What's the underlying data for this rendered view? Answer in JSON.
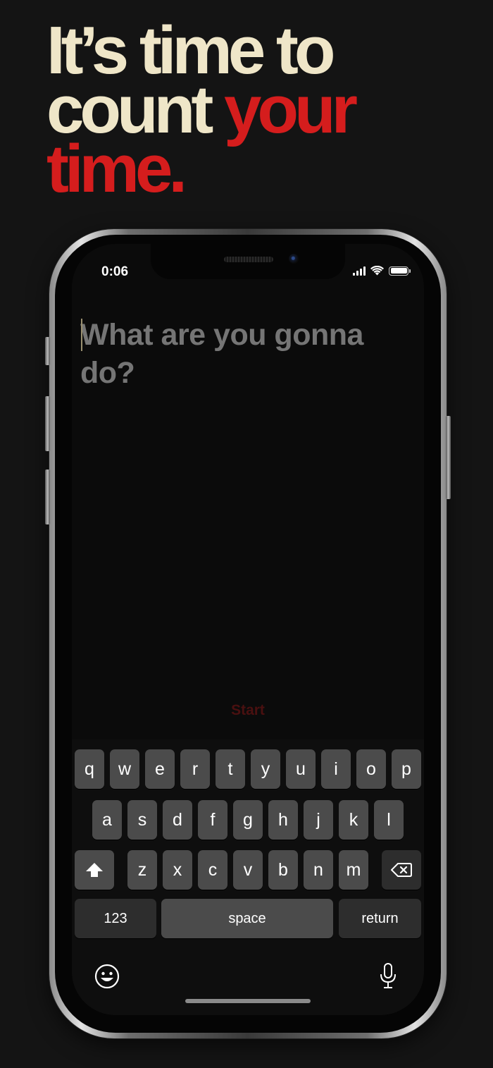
{
  "headline": {
    "line1": "It’s time to",
    "line2_a": "count ",
    "line2_b": "your",
    "line3": "time."
  },
  "status_bar": {
    "time": "0:06"
  },
  "task": {
    "placeholder": "What are you gonna do?",
    "value": ""
  },
  "start_label": "Start",
  "keyboard": {
    "row1": [
      "q",
      "w",
      "e",
      "r",
      "t",
      "y",
      "u",
      "i",
      "o",
      "p"
    ],
    "row2": [
      "a",
      "s",
      "d",
      "f",
      "g",
      "h",
      "j",
      "k",
      "l"
    ],
    "row3": [
      "z",
      "x",
      "c",
      "v",
      "b",
      "n",
      "m"
    ],
    "numbers_label": "123",
    "space_label": "space",
    "return_label": "return",
    "shift_icon": "shift-icon",
    "delete_icon": "backspace-icon",
    "emoji_icon": "emoji-icon",
    "mic_icon": "microphone-icon"
  },
  "colors": {
    "accent": "#d51d1d",
    "cream": "#efe6c8",
    "background": "#141414"
  }
}
